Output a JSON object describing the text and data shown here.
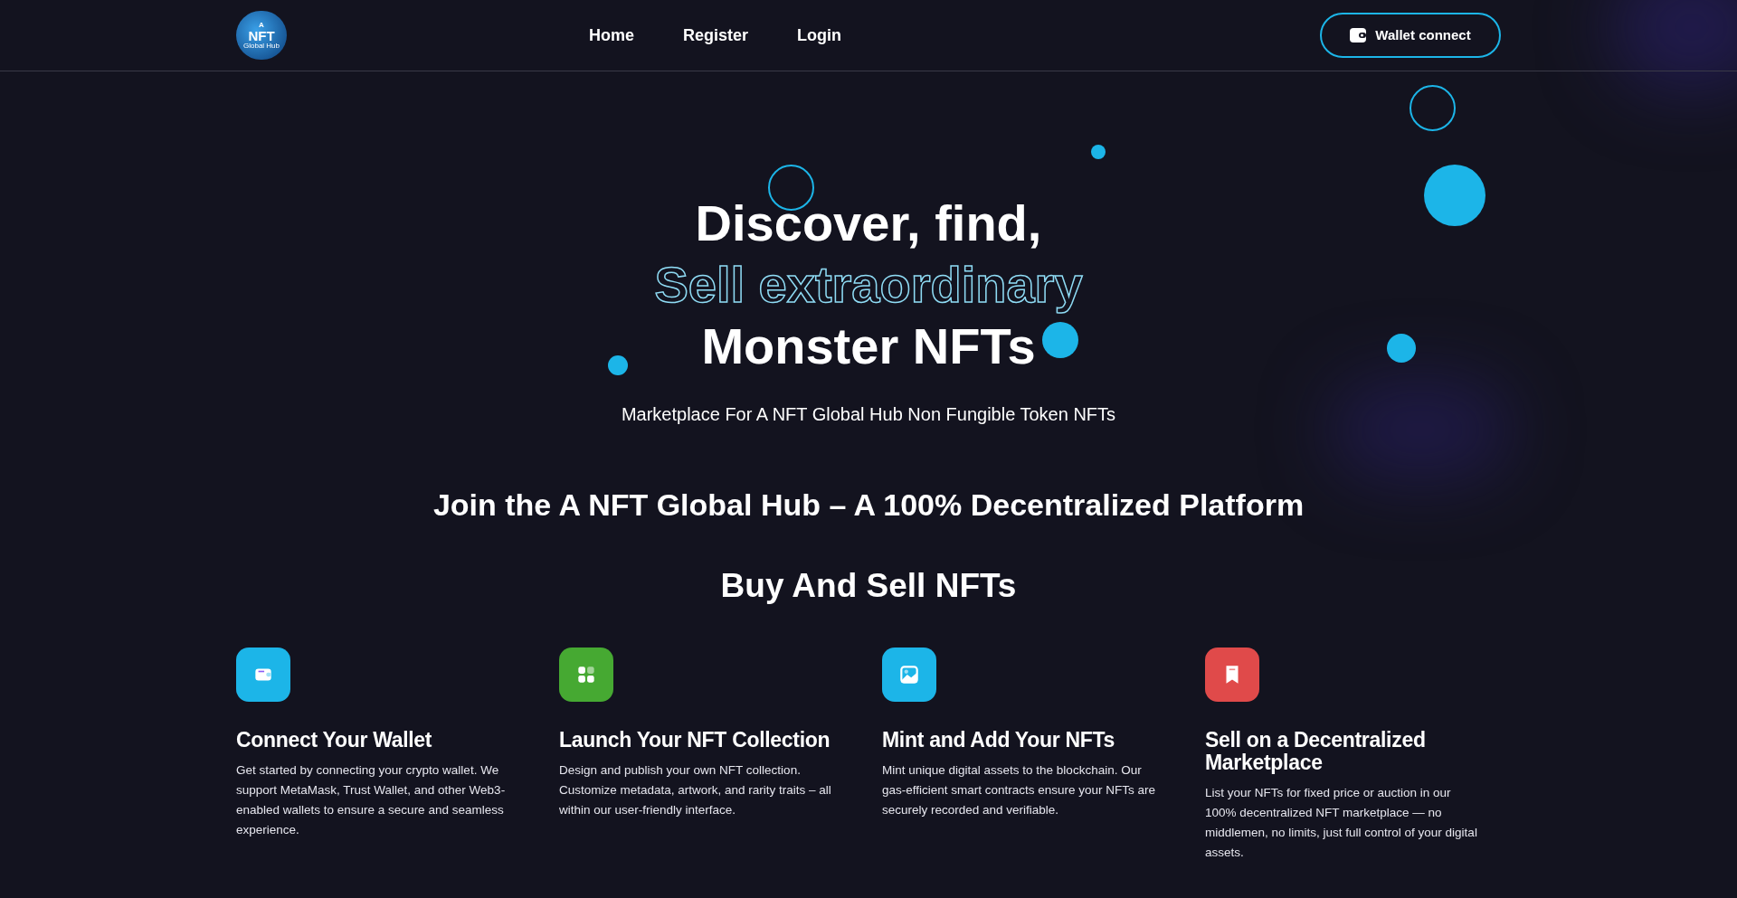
{
  "header": {
    "logo": {
      "top": "A",
      "main": "NFT",
      "sub": "Global Hub"
    },
    "nav": [
      {
        "label": "Home"
      },
      {
        "label": "Register"
      },
      {
        "label": "Login"
      }
    ],
    "wallet_button": "Wallet connect"
  },
  "hero": {
    "lines": [
      {
        "text": "Discover, find,",
        "kind": "solid"
      },
      {
        "text": "Sell extraordinary",
        "kind": "outline"
      },
      {
        "text": "Monster NFTs",
        "kind": "solid"
      }
    ],
    "subtitle": "Marketplace For A NFT Global Hub Non Fungible Token NFTs"
  },
  "intro": {
    "title": "Join the A NFT Global Hub – A 100% Decentralized Platform",
    "subtitle": "Buy And Sell NFTs"
  },
  "features": [
    {
      "kind": "wallet",
      "color": "#1cb5e8",
      "title": "Connect Your Wallet",
      "text": "Get started by connecting your crypto wallet. We support MetaMask, Trust Wallet, and other Web3-enabled wallets to ensure a secure and seamless experience."
    },
    {
      "kind": "grid",
      "color": "#46a932",
      "title": "Launch Your NFT Collection",
      "text": "Design and publish your own NFT collection. Customize metadata, artwork, and rarity traits – all within our user-friendly interface."
    },
    {
      "kind": "image",
      "color": "#1cb5e8",
      "title": "Mint and Add Your NFTs",
      "text": "Mint unique digital assets to the blockchain. Our gas-efficient smart contracts ensure your NFTs are securely recorded and verifiable."
    },
    {
      "kind": "bookmark",
      "color": "#e04a4a",
      "title": "Sell on a Decentralized Marketplace",
      "text": "List your NFTs for fixed price or auction in our 100% decentralized NFT marketplace — no middlemen, no limits, just full control of your digital assets."
    }
  ]
}
